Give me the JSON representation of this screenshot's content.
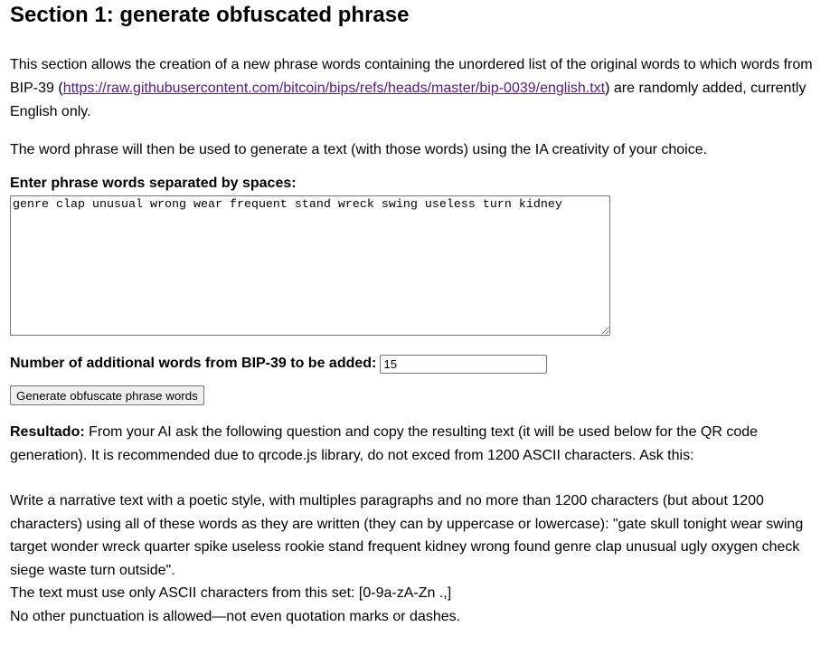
{
  "section": {
    "title": "Section 1: generate obfuscated phrase"
  },
  "intro": {
    "p1_before": "This section allows the creation of a new phrase words containing the unordered list of the original words to which words from BIP-39 (",
    "p1_link": "https://raw.githubusercontent.com/bitcoin/bips/refs/heads/master/bip-0039/english.txt",
    "p1_after": ") are randomly added, currently English only.",
    "p2": "The word phrase will then be used to generate a text (with those words) using the IA creativity of your choice."
  },
  "phrase_input": {
    "label": "Enter phrase words separated by spaces:",
    "value": "genre clap unusual wrong wear frequent stand wreck swing useless turn kidney"
  },
  "additional_words": {
    "label": "Number of additional words from BIP-39 to be added:",
    "value": "15"
  },
  "generate_button": {
    "label": "Generate obfuscate phrase words"
  },
  "result": {
    "label": "Resultado:",
    "text": " From your AI ask the following question and copy the resulting text (it will be used below for the QR code generation). It is recommended due to qrcode.js library, do not exced from 1200 ASCII characters. Ask this:"
  },
  "question": {
    "line1": "Write a narrative text with a poetic style, with multiples paragraphs and no more than 1200 characters (but about 1200 characters) using all of these words as they are written (they can by uppercase or lowercase): \"gate skull tonight wear swing target wonder wreck quarter spike useless rookie stand frequent kidney wrong found genre clap unusual ugly oxygen check siege waste turn outside\".",
    "line2": "The text must use only ASCII characters from this set: [0-9a-zA-Zn .,]",
    "line3": "No other punctuation is allowed—not even quotation marks or dashes."
  }
}
